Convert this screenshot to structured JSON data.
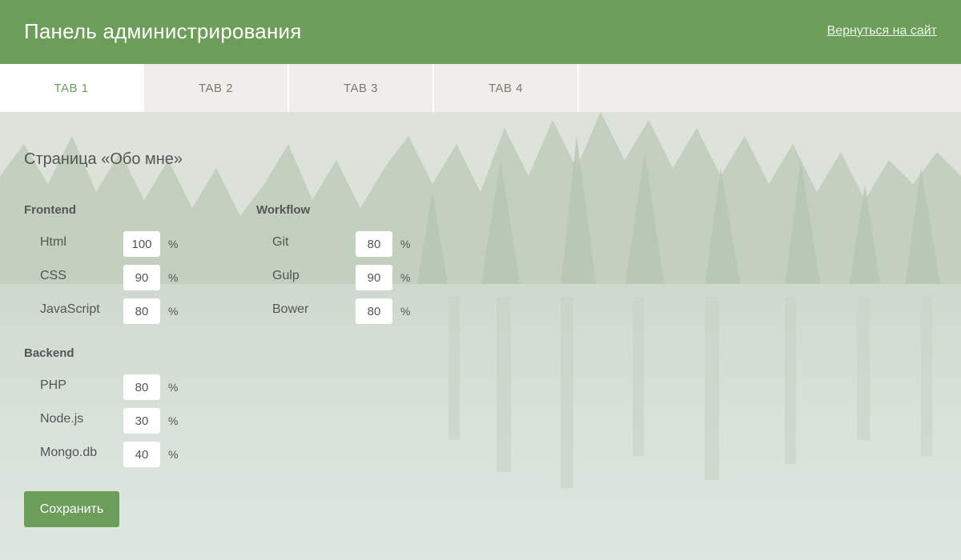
{
  "header": {
    "title": "Панель администрирования",
    "back_link": "Вернуться на сайт"
  },
  "tabs": [
    {
      "label": "TAB 1",
      "active": true
    },
    {
      "label": "TAB 2",
      "active": false
    },
    {
      "label": "TAB 3",
      "active": false
    },
    {
      "label": "TAB 4",
      "active": false
    }
  ],
  "page": {
    "title": "Страница «Обо мне»"
  },
  "groups": {
    "frontend": {
      "title": "Frontend",
      "skills": [
        {
          "name": "Html",
          "value": "100",
          "unit": "%"
        },
        {
          "name": "CSS",
          "value": "90",
          "unit": "%"
        },
        {
          "name": "JavaScript",
          "value": "80",
          "unit": "%"
        }
      ]
    },
    "workflow": {
      "title": "Workflow",
      "skills": [
        {
          "name": "Git",
          "value": "80",
          "unit": "%"
        },
        {
          "name": "Gulp",
          "value": "90",
          "unit": "%"
        },
        {
          "name": "Bower",
          "value": "80",
          "unit": "%"
        }
      ]
    },
    "backend": {
      "title": "Backend",
      "skills": [
        {
          "name": "PHP",
          "value": "80",
          "unit": "%"
        },
        {
          "name": "Node.js",
          "value": "30",
          "unit": "%"
        },
        {
          "name": "Mongo.db",
          "value": "40",
          "unit": "%"
        }
      ]
    }
  },
  "actions": {
    "save_label": "Сохранить"
  },
  "colors": {
    "accent": "#6c9e59",
    "tab_bar": "#efeeea",
    "text": "#555555"
  }
}
